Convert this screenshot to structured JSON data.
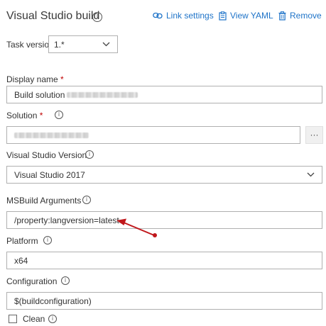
{
  "header": {
    "title": "Visual Studio build",
    "link_settings": "Link settings",
    "view_yaml": "View YAML",
    "remove": "Remove"
  },
  "task_version": {
    "label": "Task version",
    "value": "1.*"
  },
  "display_name": {
    "label": "Display name",
    "required": "*",
    "value": "Build solution"
  },
  "solution": {
    "label": "Solution",
    "required": "*",
    "browse": "···"
  },
  "vs_version": {
    "label": "Visual Studio Version",
    "value": "Visual Studio 2017"
  },
  "msbuild_args": {
    "label": "MSBuild Arguments",
    "value": "/property:langversion=latest"
  },
  "platform": {
    "label": "Platform",
    "value": "x64"
  },
  "configuration": {
    "label": "Configuration",
    "value": "$(buildconfiguration)"
  },
  "clean": {
    "label": "Clean"
  },
  "colors": {
    "link": "#1e73c8",
    "annotation_arrow": "#c0171b",
    "required": "#c00000"
  }
}
